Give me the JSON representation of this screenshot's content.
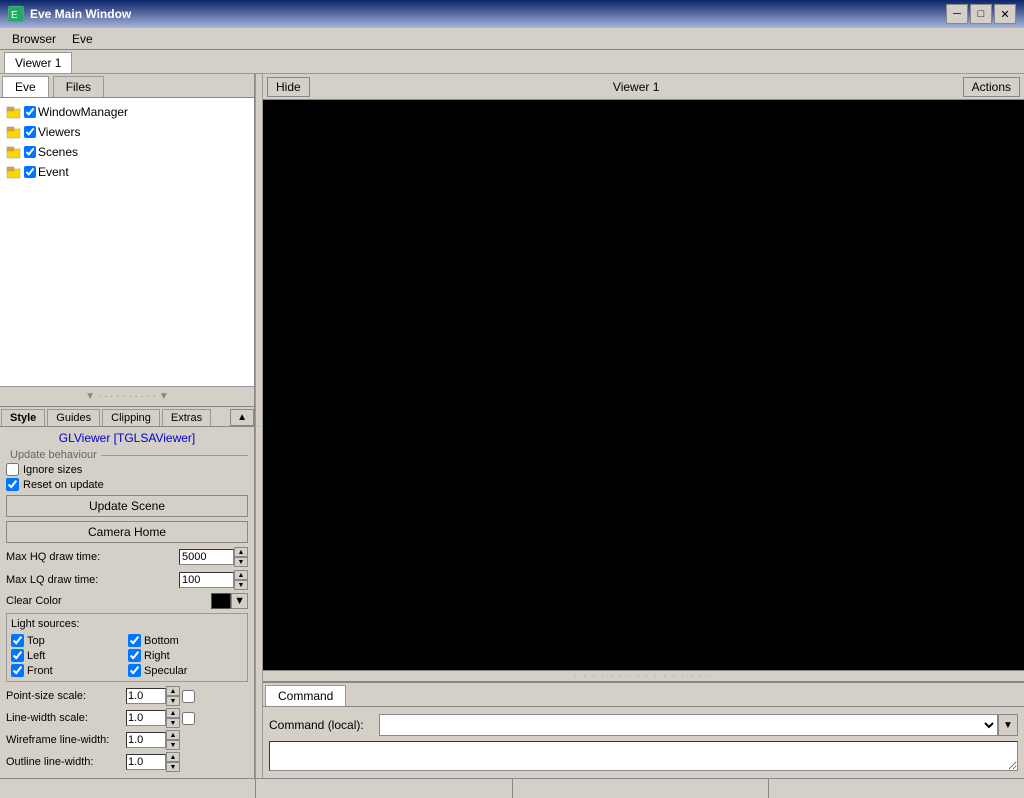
{
  "titleBar": {
    "title": "Eve Main Window",
    "minimizeLabel": "─",
    "restoreLabel": "□",
    "closeLabel": "✕"
  },
  "menuBar": {
    "items": [
      {
        "label": "Browser"
      },
      {
        "label": "Eve"
      }
    ]
  },
  "leftTabs": {
    "tabs": [
      {
        "label": "Eve",
        "active": true
      },
      {
        "label": "Files"
      }
    ]
  },
  "tree": {
    "items": [
      {
        "label": "WindowManager",
        "indent": 0
      },
      {
        "label": "Viewers",
        "indent": 0
      },
      {
        "label": "Scenes",
        "indent": 0
      },
      {
        "label": "Event",
        "indent": 0
      }
    ]
  },
  "propsTabs": {
    "tabs": [
      {
        "label": "Style",
        "active": true
      },
      {
        "label": "Guides"
      },
      {
        "label": "Clipping"
      },
      {
        "label": "Extras"
      }
    ]
  },
  "props": {
    "viewerLink": "GLViewer [TGLSAViewer]",
    "updateBehaviourLabel": "Update behaviour",
    "ignoreSizesLabel": "Ignore sizes",
    "resetOnUpdateLabel": "Reset on update",
    "updateSceneLabel": "Update Scene",
    "cameraHomeLabel": "Camera Home",
    "maxHQLabel": "Max HQ draw time:",
    "maxHQValue": "5000",
    "maxLQLabel": "Max LQ draw time:",
    "maxLQValue": "100",
    "clearColorLabel": "Clear Color",
    "lightSourcesLabel": "Light sources:",
    "topLabel": "Top",
    "bottomLabel": "Bottom",
    "leftLabel": "Left",
    "rightLabel": "Right",
    "frontLabel": "Front",
    "specularLabel": "Specular",
    "pointSizeLabel": "Point-size scale:",
    "pointSizeValue": "1.0",
    "lineWidthLabel": "Line-width scale:",
    "lineWidthValue": "1.0",
    "wireframeLabel": "Wireframe line-width:",
    "wireframeValue": "1.0",
    "outlineLabel": "Outline line-width:",
    "outlineValue": "1.0"
  },
  "viewerTab": {
    "label": "Viewer 1"
  },
  "viewerHeader": {
    "hideLabel": "Hide",
    "title": "Viewer 1",
    "actionsLabel": "Actions"
  },
  "splitter": {
    "dots": "· · · · · · · · · · · · · · · ·"
  },
  "commandPanel": {
    "tabLabel": "Command",
    "commandLocalLabel": "Command (local):",
    "placeholder": ""
  },
  "statusBar": {
    "cells": [
      "",
      "",
      "",
      ""
    ]
  }
}
